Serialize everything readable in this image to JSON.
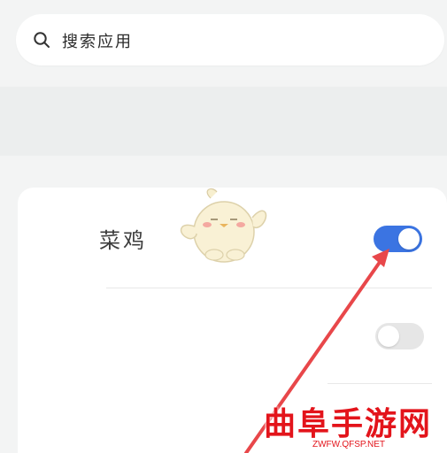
{
  "search": {
    "placeholder": "搜索应用",
    "icon": "search-icon"
  },
  "app_list": {
    "items": [
      {
        "name": "菜鸡",
        "enabled": true
      },
      {
        "name": "",
        "enabled": false
      }
    ]
  },
  "colors": {
    "toggle_on": "#3b74e2",
    "toggle_off": "#e6e6e6",
    "arrow": "#e8474a",
    "watermark": "#e3141b"
  },
  "watermark": {
    "title": "曲阜手游网",
    "url": "ZWFW.QFSP.NET"
  }
}
